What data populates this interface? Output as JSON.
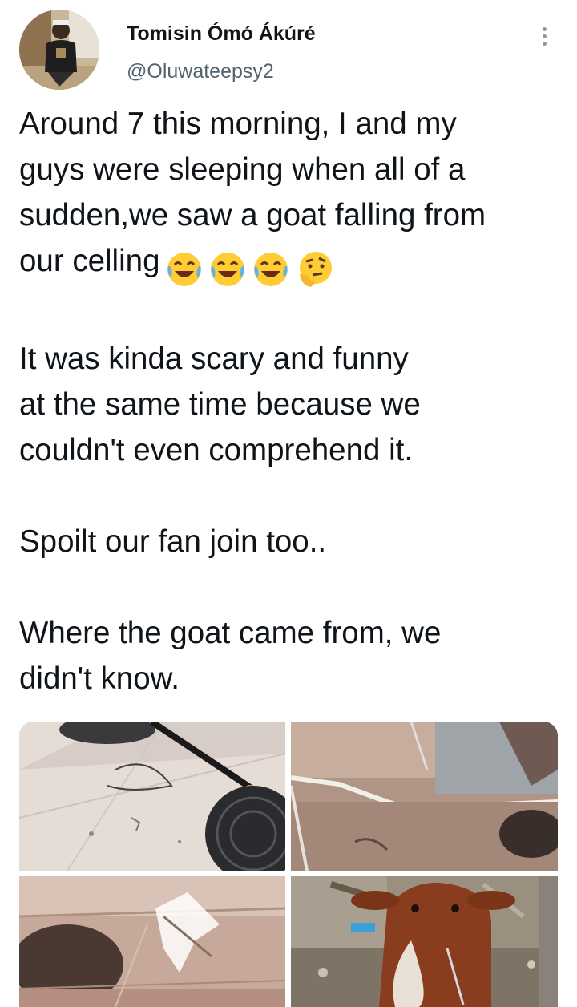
{
  "author": {
    "display_name": "Tomisin Ómó Ákúré",
    "handle": "@Oluwateepsy2"
  },
  "tweet": {
    "paragraph_1_lines": [
      "Around 7 this morning, I and my",
      "guys were sleeping when all of a",
      "sudden,we saw a goat falling from",
      "our celling"
    ],
    "paragraph_1_emojis": [
      "face-with-tears-of-joy",
      "face-with-tears-of-joy",
      "face-with-tears-of-joy",
      "thinking-face"
    ],
    "paragraph_2_lines": [
      "It was kinda scary and funny",
      "at the same time because we",
      "couldn't even comprehend it."
    ],
    "paragraph_3": "Spoilt our fan join too..",
    "paragraph_4_lines": [
      "Where the goat came from, we",
      "didn't know."
    ]
  },
  "icons": {
    "more": "more-options-icon"
  },
  "colors": {
    "text": "#0f1419",
    "secondary_text": "#536471",
    "more_icon": "#8899a6"
  }
}
